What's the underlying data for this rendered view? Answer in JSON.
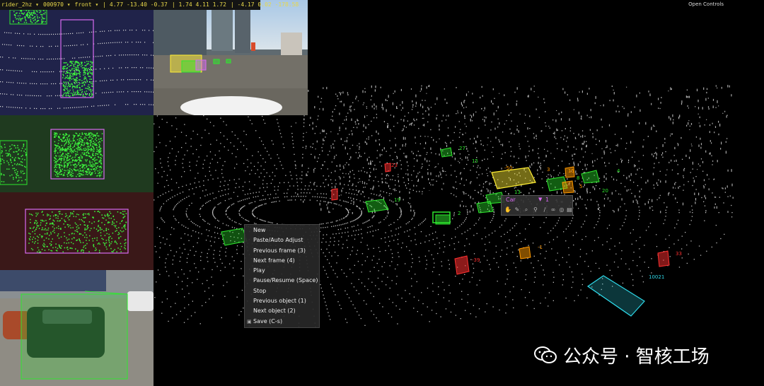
{
  "header": {
    "scene": "rider_2hz",
    "frame": "000970",
    "camera": "front",
    "position": "4.77 -13.40 -0.37",
    "scale": "1.74 4.11 1.72",
    "rotation": "-4.17 0.02 -178.58"
  },
  "open_controls": "Open Controls",
  "context_menu": [
    {
      "label": "New"
    },
    {
      "label": "Paste/Auto Adjust"
    },
    {
      "label": "Previous frame (3)"
    },
    {
      "label": "Next frame (4)"
    },
    {
      "label": "Play"
    },
    {
      "label": "Pause/Resume (Space)"
    },
    {
      "label": "Stop"
    },
    {
      "label": "Previous object (1)"
    },
    {
      "label": "Next object (2)"
    },
    {
      "label": "Save (C-s)"
    }
  ],
  "object_toolbar": {
    "class": "Car",
    "id": "1",
    "tools": [
      "hand-icon",
      "wrench-icon",
      "zoom-icon",
      "pin-icon",
      "draw-icon",
      "link-icon",
      "target-icon",
      "trash-icon"
    ]
  },
  "box_labels": [
    {
      "text": "27",
      "color": "#2ee82e"
    },
    {
      "text": "15",
      "color": "#2ee82e"
    },
    {
      "text": "-50",
      "color": "#ff9900"
    },
    {
      "text": "3",
      "color": "#ff9900"
    },
    {
      "text": "15",
      "color": "#ff9900"
    },
    {
      "text": "8",
      "color": "#2ee82e"
    },
    {
      "text": "4",
      "color": "#2ee82e"
    },
    {
      "text": "5",
      "color": "#ff9900"
    },
    {
      "text": "20",
      "color": "#2ee82e"
    },
    {
      "text": "13",
      "color": "#2ee82e"
    },
    {
      "text": "2",
      "color": "#2ee82e"
    },
    {
      "text": "19",
      "color": "#2ee82e"
    },
    {
      "text": "-1",
      "color": "#ff9900"
    },
    {
      "text": "23",
      "color": "#ff3030"
    },
    {
      "text": "-39",
      "color": "#ff3030"
    },
    {
      "text": "10021",
      "color": "#2ed8e8"
    },
    {
      "text": "33",
      "color": "#ff3030"
    }
  ],
  "watermark": {
    "text": "公众号 · 智核工场"
  },
  "colors": {
    "car": "#2ee82e",
    "pedestrian": "#ff3030",
    "rider": "#ff9900",
    "truck": "#2ed8e8",
    "bus": "#ffee33",
    "selected": "#d86af0"
  }
}
